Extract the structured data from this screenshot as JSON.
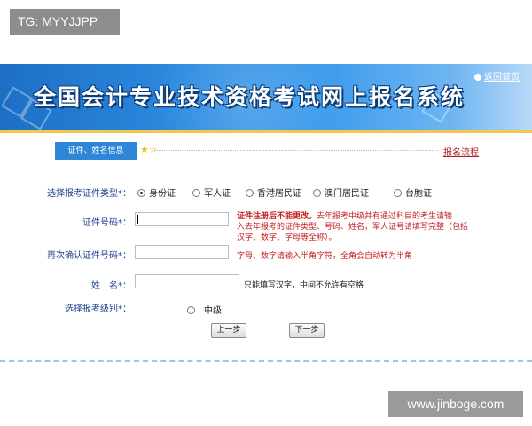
{
  "watermark_tag": "TG: MYYJJPP",
  "banner": {
    "title": "全国会计专业技术资格考试网上报名系统",
    "home_link": "返回首页"
  },
  "tabs": {
    "active": "证件、姓名信息",
    "process_link": "报名流程"
  },
  "form": {
    "id_type_label": "选择报考证件类型*：",
    "id_types": [
      "身份证",
      "军人证",
      "香港居民证",
      "澳门居民证",
      "台胞证"
    ],
    "selected_id_type": "身份证",
    "id_number_label": "证件号码*：",
    "id_number_value": "",
    "id_note_bold": "证件注册后不能更改。",
    "id_note_line1": "去年报考中级并有通过科目的考生请输",
    "id_note_line2": "入去年报考的证件类型、号码、姓名，军人证号请填写完整（包括",
    "id_note_line3": "汉字、数字、字母等全称）。",
    "confirm_label": "再次确认证件号码*：",
    "confirm_note": "字母、数字请输入半角字符，全角会自动转为半角",
    "name_label": "姓　名*：",
    "name_note": "只能填写汉字，中间不允许有空格",
    "level_label": "选择报考级别*：",
    "level_option": "中级",
    "prev_button": "上一步",
    "next_button": "下一步"
  },
  "site_watermark": "www.jinboge.com"
}
